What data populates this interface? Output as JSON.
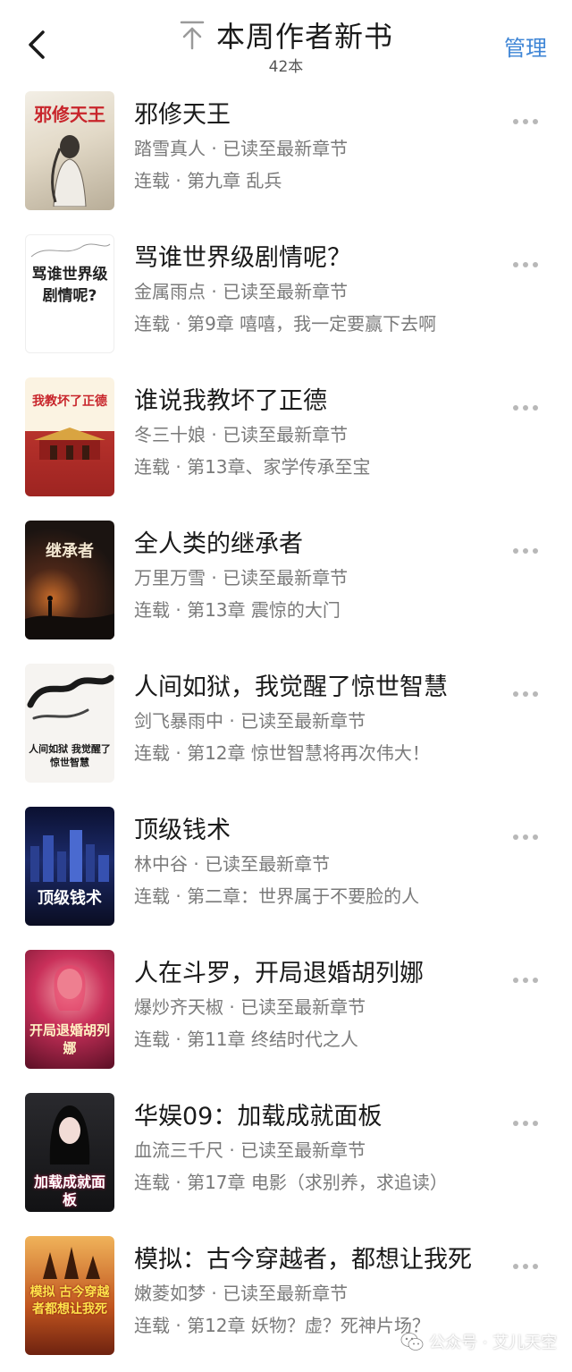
{
  "header": {
    "title": "本周作者新书",
    "subtitle": "42本",
    "manage_label": "管理",
    "back_icon": "chevron-left-icon",
    "title_icon": "arrow-up-to-top-icon"
  },
  "colors": {
    "accent": "#3f86d6",
    "text_primary": "#1a1a1a",
    "text_secondary": "#7a7a7a",
    "more_dots": "#b8b8b8"
  },
  "books": [
    {
      "title": "邪修天王",
      "author_line": "踏雪真人 · 已读至最新章节",
      "status_line": "连载 · 第九章 乱兵",
      "cover_text": "邪修天王"
    },
    {
      "title": "骂谁世界级剧情呢？",
      "author_line": "金属雨点 · 已读至最新章节",
      "status_line": "连载 · 第9章 嘻嘻，我一定要赢下去啊",
      "cover_text": "骂谁世界级剧情呢?"
    },
    {
      "title": "谁说我教坏了正德",
      "author_line": "冬三十娘 · 已读至最新章节",
      "status_line": "连载 · 第13章、家学传承至宝",
      "cover_text": "我教坏了正德"
    },
    {
      "title": "全人类的继承者",
      "author_line": "万里万雪 · 已读至最新章节",
      "status_line": "连载 · 第13章 震惊的大门",
      "cover_text": "继承者"
    },
    {
      "title": "人间如狱，我觉醒了惊世智慧",
      "author_line": "剑飞暴雨中 · 已读至最新章节",
      "status_line": "连载 · 第12章 惊世智慧将再次伟大！",
      "cover_text": "人间如狱 我觉醒了惊世智慧"
    },
    {
      "title": "顶级钱术",
      "author_line": "林中谷 · 已读至最新章节",
      "status_line": "连载 · 第二章：世界属于不要脸的人",
      "cover_text": "顶级钱术"
    },
    {
      "title": "人在斗罗，开局退婚胡列娜",
      "author_line": "爆炒齐天椒 · 已读至最新章节",
      "status_line": "连载 · 第11章 终结时代之人",
      "cover_text": "开局退婚胡列娜"
    },
    {
      "title": "华娱09：加载成就面板",
      "author_line": "血流三千尺 · 已读至最新章节",
      "status_line": "连载 · 第17章 电影（求别养，求追读）",
      "cover_text": "加载成就面板"
    },
    {
      "title": "模拟：古今穿越者，都想让我死",
      "author_line": "嫩菱如梦 · 已读至最新章节",
      "status_line": "连载 · 第12章 妖物？虚？死神片场？",
      "cover_text": "模拟 古今穿越者都想让我死"
    }
  ],
  "watermark": {
    "text": "公众号 · 艾儿天空",
    "icon": "wechat-icon"
  }
}
